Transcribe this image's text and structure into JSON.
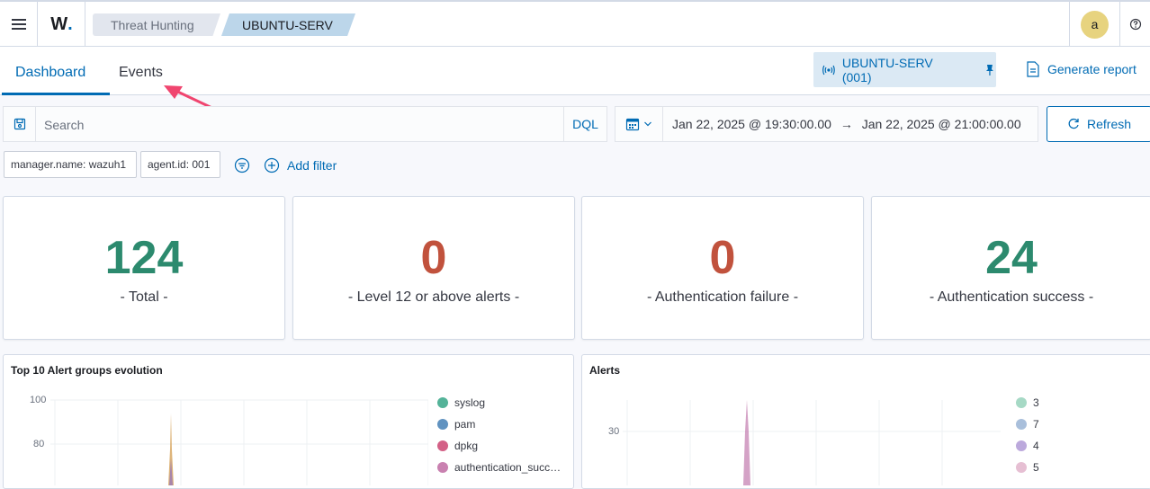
{
  "header": {
    "logo_text": "W",
    "logo_dot": ".",
    "breadcrumbs": [
      "Threat Hunting",
      "UBUNTU-SERV"
    ],
    "avatar_letter": "a"
  },
  "tabs": {
    "dashboard": "Dashboard",
    "events": "Events"
  },
  "agent_button": "UBUNTU-SERV (001)",
  "generate_report": "Generate report",
  "search": {
    "placeholder": "Search",
    "language": "DQL"
  },
  "date_range": {
    "start": "Jan 22, 2025 @ 19:30:00.00",
    "arrow": "→",
    "end": "Jan 22, 2025 @ 21:00:00.00"
  },
  "refresh_label": "Refresh",
  "filters": [
    "manager.name: wazuh1",
    "agent.id: 001"
  ],
  "add_filter_label": "Add filter",
  "stats": [
    {
      "value": "124",
      "label": "- Total -",
      "color": "#2c8a6e"
    },
    {
      "value": "0",
      "label": "- Level 12 or above alerts -",
      "color": "#c1523d"
    },
    {
      "value": "0",
      "label": "- Authentication failure -",
      "color": "#c1523d"
    },
    {
      "value": "24",
      "label": "- Authentication success -",
      "color": "#2c8a6e"
    }
  ],
  "panels": {
    "groups": {
      "title": "Top 10 Alert groups evolution",
      "y_ticks": [
        "100",
        "80"
      ],
      "legend": [
        {
          "label": "syslog",
          "color": "#54b399"
        },
        {
          "label": "pam",
          "color": "#6092c0"
        },
        {
          "label": "dpkg",
          "color": "#d36086"
        },
        {
          "label": "authentication_succ…",
          "color": "#c981b0"
        }
      ]
    },
    "alerts": {
      "title": "Alerts",
      "y_ticks": [
        "30"
      ],
      "legend": [
        {
          "label": "3",
          "color": "#a6d9c5"
        },
        {
          "label": "7",
          "color": "#a9bfdb"
        },
        {
          "label": "4",
          "color": "#bca9dc"
        },
        {
          "label": "5",
          "color": "#e6bfd3"
        }
      ]
    }
  }
}
